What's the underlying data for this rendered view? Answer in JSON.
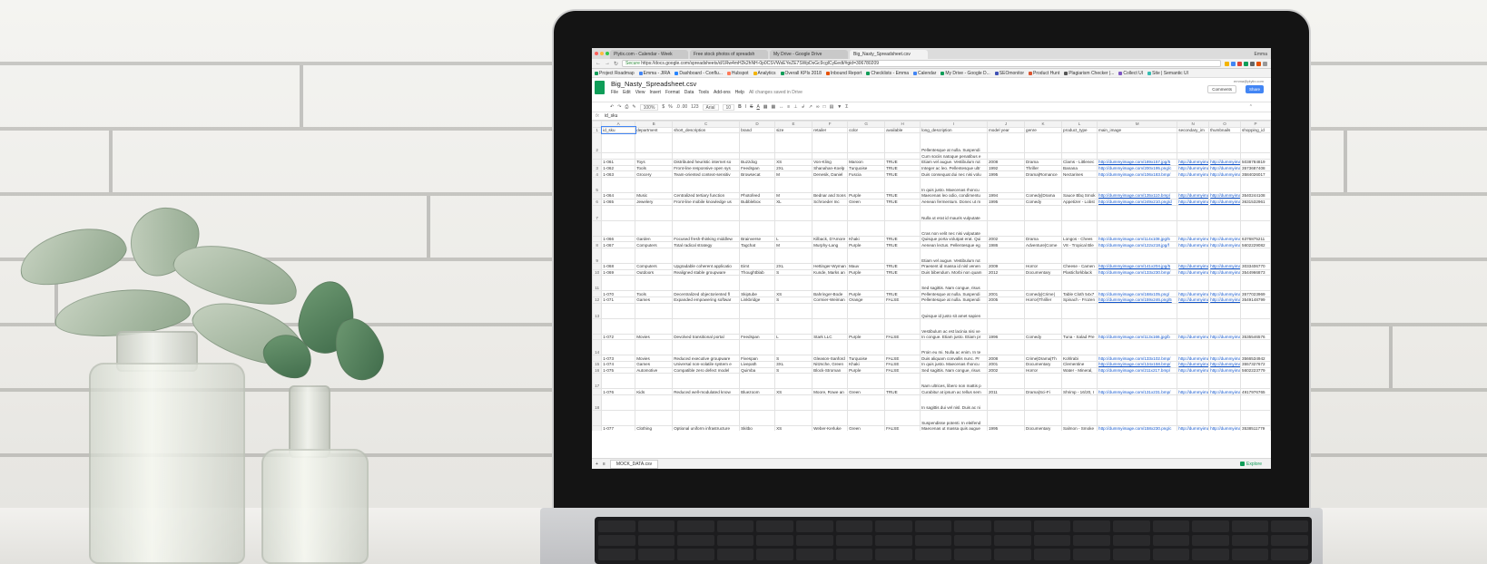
{
  "browser": {
    "tabs": [
      {
        "label": "Plytix.com - Calendar - Week",
        "active": false
      },
      {
        "label": "Free stock photos of spreadsh",
        "active": false
      },
      {
        "label": "My Drive - Google Drive",
        "active": false
      },
      {
        "label": "Big_Nasty_Spreadsheet.csv",
        "active": true
      }
    ],
    "user": "Emma",
    "secure_label": "Secure",
    "url": "https://docs.google.com/spreadsheets/d/1Rw4mH2k2hNH-0p0CSVWsEYeZE7SWpDsGc9cglCyEedt/#gid=306780209",
    "bookmarks": [
      "Project Roadmap",
      "Emma - JIRA",
      "Dashboard - Conflu...",
      "Hubspot",
      "Analytics",
      "Overall KPIs 2018",
      "Inbound Report",
      "Checklists - Emma",
      "Calendar",
      "My Drive - Google D...",
      "SEOmonitor",
      "Product Hunt",
      "Plagiarism Checker |...",
      "Collect UI",
      "Site | Semantic UI"
    ]
  },
  "sheets": {
    "title": "Big_Nasty_Spreadsheet.csv",
    "menu": [
      "File",
      "Edit",
      "View",
      "Insert",
      "Format",
      "Data",
      "Tools",
      "Add-ons",
      "Help"
    ],
    "saved_note": "All changes saved in Drive",
    "account": "emma@plytix.com",
    "comments_label": "Comments",
    "share_label": "Share",
    "toolbar": {
      "zoom": "100%",
      "currency": "$",
      "percent": "%",
      "decimals": ".0 .00",
      "format": "123",
      "font": "Arial",
      "size": "10"
    },
    "formula_cell": "id_sku",
    "fx": "fx",
    "columns": [
      "A",
      "B",
      "C",
      "D",
      "E",
      "F",
      "G",
      "H",
      "I",
      "J",
      "K",
      "L",
      "M",
      "N",
      "O",
      "P"
    ],
    "headers": [
      "id_sku",
      "department",
      "short_description",
      "brand",
      "size",
      "retailer",
      "color",
      "available",
      "long_description",
      "model year",
      "genre",
      "product_type",
      "main_image",
      "secondary_im",
      "thumbnails",
      "shopping_id"
    ],
    "rows": [
      {
        "n": "2",
        "cls": "taller",
        "cells": [
          "",
          "",
          "",
          "",
          "",
          "",
          "",
          "",
          "Pellentesque at nulla. Suspendi",
          "",
          "",
          "",
          "",
          "",
          "",
          ""
        ]
      },
      {
        "n": "",
        "cls": "",
        "cells": [
          "",
          "",
          "",
          "",
          "",
          "",
          "",
          "",
          "Cum sociis natoque penatibus e",
          "",
          "",
          "",
          "",
          "",
          "",
          ""
        ]
      },
      {
        "n": "",
        "cls": "",
        "cells": [
          "1-061",
          "Toys",
          "Distributed heuristic internet so",
          "Buzzdog",
          "XS",
          "Von-Kling",
          "Maroon",
          "TRUE",
          "Etiam vel augue. Vestibulum rut",
          "2008",
          "Drama",
          "Clams - Littlenec",
          "http://dummyimage.com/189x157.jpg/5",
          "http://dummyima",
          "http://dummyima",
          "5038784819"
        ]
      },
      {
        "n": "3",
        "cls": "",
        "cells": [
          "1-062",
          "Tools",
          "Front-line responsive open sys",
          "Feedspan",
          "2XL",
          "Shanahan-Koelp",
          "Turquoise",
          "TRUE",
          "Integer ac leo. Pellentesque ultr",
          "1992",
          "Thriller",
          "Banana",
          "http://dummyimage.com/200x195.png/c",
          "http://dummyima",
          "http://dummyima",
          "3573687408"
        ]
      },
      {
        "n": "4",
        "cls": "",
        "cells": [
          "1-063",
          "Grocery",
          "Team-oriented context-sensitiv",
          "Browsecat",
          "M",
          "Denesik, Daniel",
          "Fuscia",
          "TRUE",
          "Duis consequat dui nec nisi volu",
          "1995",
          "Drama|Romance",
          "Nectarines",
          "http://dummyimage.com/106x183.bmp/",
          "http://dummyima",
          "http://dummyima",
          "3584026017"
        ]
      },
      {
        "n": "5",
        "cls": "tall",
        "cells": [
          "",
          "",
          "",
          "",
          "",
          "",
          "",
          "",
          "In quis justo. Maecenas rhoncu",
          "",
          "",
          "",
          "",
          "",
          "",
          ""
        ]
      },
      {
        "n": "",
        "cls": "",
        "cells": [
          "1-064",
          "Music",
          "Centralized tertiary function",
          "Photofeed",
          "M",
          "Bednar and Sons",
          "Purple",
          "TRUE",
          "Maecenas leo odio, condimentu",
          "1994",
          "Comedy|Drama",
          "Sauce Bbq Smok",
          "http://dummyimage.com/135x110.bmp/",
          "http://dummyima",
          "http://dummyima",
          "3540244108"
        ]
      },
      {
        "n": "6",
        "cls": "",
        "cells": [
          "1-065",
          "Jewelery",
          "Front-line mobile knowledge us",
          "Bubblebox",
          "XL",
          "Schroeder Inc",
          "Green",
          "TRUE",
          "Aenean fermentum. Donec ut m",
          "1995",
          "Comedy",
          "Appetizer - Lobst",
          "http://dummyimage.com/249x210.png/d",
          "http://dummyima",
          "http://dummyima",
          "3631532961"
        ]
      },
      {
        "n": "7",
        "cls": "tall",
        "cells": [
          "",
          "",
          "",
          "",
          "",
          "",
          "",
          "",
          "Nulla ut erat id mauris vulputate",
          "",
          "",
          "",
          "",
          "",
          "",
          ""
        ]
      },
      {
        "n": "",
        "cls": "tall",
        "cells": [
          "",
          "",
          "",
          "",
          "",
          "",
          "",
          "",
          "Cras non velit nec nisi vulputate",
          "",
          "",
          "",
          "",
          "",
          "",
          ""
        ]
      },
      {
        "n": "",
        "cls": "",
        "cells": [
          "1-066",
          "Garden",
          "Focused fresh-thinking middlew",
          "Brainverse",
          "L",
          "Kilback, D'Amore",
          "Khaki",
          "TRUE",
          "Quisque porta volutpat erat. Qui",
          "2002",
          "Drama",
          "Longos - Chees",
          "http://dummyimage.com/114x108.jpg/5",
          "http://dummyima",
          "http://dummyima",
          "6376875211"
        ]
      },
      {
        "n": "8",
        "cls": "",
        "cells": [
          "1-067",
          "Computers",
          "Total radical strategy",
          "Tagchat",
          "M",
          "Murphy-Lang",
          "Purple",
          "TRUE",
          "Aenean lectus. Pellentesque eg",
          "1986",
          "Adventure|Come",
          "V8 - Tropical Ble",
          "http://dummyimage.com/122x218.jpg/f",
          "http://dummyima",
          "http://dummyima",
          "5602229082"
        ]
      },
      {
        "n": "9",
        "cls": "tall",
        "cells": [
          "",
          "",
          "",
          "",
          "",
          "",
          "",
          "",
          "Etiam vel augue. Vestibulum rut",
          "",
          "",
          "",
          "",
          "",
          "",
          ""
        ]
      },
      {
        "n": "",
        "cls": "",
        "cells": [
          "1-068",
          "Computers",
          "Upgradable coherent applicatio",
          "Eimt",
          "2XL",
          "Hettinger-Wyman",
          "Mauv",
          "TRUE",
          "Praesent id massa id nisl venen",
          "2009",
          "Horror",
          "Cheese - Camen",
          "http://dummyimage.com/141x204.jpg/5",
          "http://dummyima",
          "http://dummyima",
          "3033406770"
        ]
      },
      {
        "n": "10",
        "cls": "",
        "cells": [
          "1-069",
          "Outdoors",
          "Realigned stable groupware",
          "Thoughtblab",
          "S",
          "Kunde, Marks an",
          "Purple",
          "TRUE",
          "Duis bibendum. Morbi non quam",
          "2012",
          "Documentary",
          "Plasticforkblack",
          "http://dummyimage.com/133x230.bmp/",
          "http://dummyima",
          "http://dummyima",
          "3544966873"
        ]
      },
      {
        "n": "11",
        "cls": "tall",
        "cells": [
          "",
          "",
          "",
          "",
          "",
          "",
          "",
          "",
          "Sed sagittis. Nam congue, risus",
          "",
          "",
          "",
          "",
          "",
          "",
          ""
        ]
      },
      {
        "n": "",
        "cls": "",
        "cells": [
          "1-070",
          "Tools",
          "Decentralized objectoriented fl",
          "Skiptube",
          "XS",
          "Bahringer-Bode",
          "Purple",
          "TRUE",
          "Pellentesque at nulla. Suspendi",
          "2001",
          "Comedy|Crime|",
          "Table Cloth 54x7",
          "http://dummyimage.com/168x105.png/",
          "http://dummyima",
          "http://dummyima",
          "3577023969"
        ]
      },
      {
        "n": "12",
        "cls": "",
        "cells": [
          "1-071",
          "Games",
          "Expanded empowering softwar",
          "Linkbridge",
          "S",
          "Cormier-Weiman",
          "Orange",
          "FALSE",
          "Pellentesque at nulla. Suspendi",
          "2005",
          "Horror|Thriller",
          "Spinach - Frozen",
          "http://dummyimage.com/159x246.png/5",
          "http://dummyima",
          "http://dummyima",
          "3549148799"
        ]
      },
      {
        "n": "13",
        "cls": "tall",
        "cells": [
          "",
          "",
          "",
          "",
          "",
          "",
          "",
          "",
          "Quisque id justo sit amet sapien",
          "",
          "",
          "",
          "",
          "",
          "",
          ""
        ]
      },
      {
        "n": "",
        "cls": "tall",
        "cells": [
          "",
          "",
          "",
          "",
          "",
          "",
          "",
          "",
          "Vestibulum ac est lacinia nisi ve",
          "",
          "",
          "",
          "",
          "",
          "",
          ""
        ]
      },
      {
        "n": "",
        "cls": "",
        "cells": [
          "1-072",
          "Movies",
          "Devolved transitional portal",
          "Feedspan",
          "L",
          "Stark LLC",
          "Purple",
          "FALSE",
          "In congue. Etiam justo. Etiam pr",
          "1996",
          "Comedy",
          "Tuna - Salad Pre",
          "http://dummyimage.com/113x166.jpg/b",
          "http://dummyima",
          "http://dummyima",
          "3535546576"
        ]
      },
      {
        "n": "14",
        "cls": "tall",
        "cells": [
          "",
          "",
          "",
          "",
          "",
          "",
          "",
          "",
          "Proin eu mi. Nulla ac enim. In te",
          "",
          "",
          "",
          "",
          "",
          "",
          ""
        ]
      },
      {
        "n": "",
        "cls": "",
        "cells": [
          "1-073",
          "Movies",
          "Reduced executive groupware",
          "Fivespan",
          "S",
          "Gleason-Sanford",
          "Turquoise",
          "FALSE",
          "Duis aliquam convallis nunc. Pr",
          "2008",
          "Crime|Drama|Th",
          "Kohlrabi",
          "http://dummyimage.com/133x102.bmp/",
          "http://dummyima",
          "http://dummyima",
          "3566534942"
        ]
      },
      {
        "n": "15",
        "cls": "",
        "cells": [
          "1-074",
          "Games",
          "Universal non-volatile system e",
          "Livepath",
          "3XL",
          "Nitzsche, Green",
          "Khaki",
          "FALSE",
          "In quis justo. Maecenas rhoncu",
          "2001",
          "Documentary",
          "Clementine",
          "http://dummyimage.com/134x158.bmp/",
          "http://dummyima",
          "http://dummyima",
          "3557327672"
        ]
      },
      {
        "n": "16",
        "cls": "",
        "cells": [
          "1-075",
          "Automotive",
          "Compatible zero defect model",
          "Quimba",
          "S",
          "Block-Stroman",
          "Purple",
          "FALSE",
          "Sed sagittis. Nam congue, risus",
          "2002",
          "Horror",
          "Water - Mineral,",
          "http://dummyimage.com/211x217.bmp/",
          "http://dummyima",
          "http://dummyima",
          "5602223779"
        ]
      },
      {
        "n": "17",
        "cls": "tall",
        "cells": [
          "",
          "",
          "",
          "",
          "",
          "",
          "",
          "",
          "Nam ultrices, libero non mattis p",
          "",
          "",
          "",
          "",
          "",
          "",
          ""
        ]
      },
      {
        "n": "",
        "cls": "",
        "cells": [
          "1-076",
          "Kids",
          "Reduced well-modulated know",
          "Bluezoom",
          "XS",
          "Moore, Rowe an",
          "Green",
          "TRUE",
          "Curabitur at ipsum ac tellus sem",
          "2011",
          "Drama|Sci-Fi",
          "Shrimp - 16/20, I",
          "http://dummyimage.com/131x231.bmp/",
          "http://dummyima",
          "http://dummyima",
          "4917976765"
        ]
      },
      {
        "n": "18",
        "cls": "tall",
        "cells": [
          "",
          "",
          "",
          "",
          "",
          "",
          "",
          "",
          "In sagittis dui vel nisl. Duis ac ni",
          "",
          "",
          "",
          "",
          "",
          "",
          ""
        ]
      },
      {
        "n": "",
        "cls": "tall",
        "cells": [
          "",
          "",
          "",
          "",
          "",
          "",
          "",
          "",
          "Suspendisse potenti. In eleifend",
          "",
          "",
          "",
          "",
          "",
          "",
          ""
        ]
      },
      {
        "n": "",
        "cls": "",
        "cells": [
          "1-077",
          "Clothing",
          "Optional uniform infrastructure",
          "Skitbo",
          "XS",
          "Weber-Kerluke",
          "Green",
          "FALSE",
          "Maecenas ut massa quis augue",
          "1995",
          "Documentary",
          "Salmon - Smoke",
          "http://dummyimage.com/158x230.png/c",
          "http://dummyima",
          "http://dummyima",
          "3538511779"
        ]
      }
    ],
    "sheet_tab": "MOCK_DATA.csv",
    "explore_label": "Explore"
  },
  "colors": {
    "sheets_green": "#0f9d58",
    "share_blue": "#4285f4",
    "link_blue": "#1155cc"
  }
}
